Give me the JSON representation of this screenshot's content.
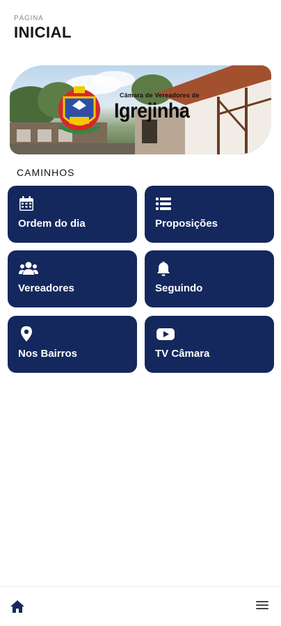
{
  "header": {
    "sup": "PÁGINA",
    "title": "INICIAL"
  },
  "banner": {
    "line1": "Câmara de Vereadores de",
    "line2": "Igrejinha"
  },
  "section": {
    "label": "CAMINHOS"
  },
  "tiles": [
    {
      "label": "Ordem do dia",
      "icon": "calendar-icon"
    },
    {
      "label": "Proposições",
      "icon": "list-icon"
    },
    {
      "label": "Vereadores",
      "icon": "users-icon"
    },
    {
      "label": "Seguindo",
      "icon": "bell-icon"
    },
    {
      "label": "Nos Bairros",
      "icon": "map-pin-icon"
    },
    {
      "label": "TV Câmara",
      "icon": "youtube-icon"
    }
  ],
  "nav": {
    "left_icon": "home-icon",
    "right_icon": "menu-icon"
  },
  "colors": {
    "tile": "#14285e",
    "accent": "#14285e"
  }
}
